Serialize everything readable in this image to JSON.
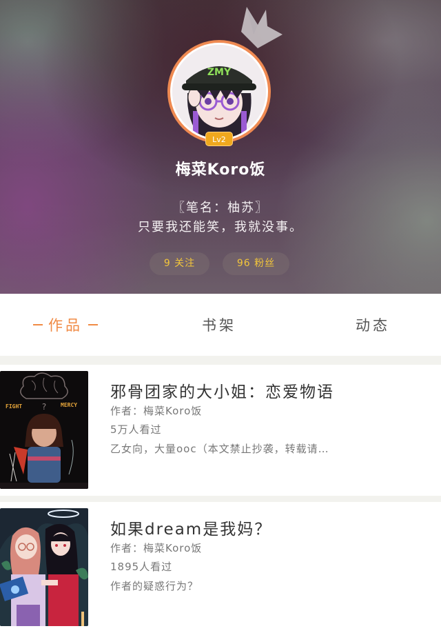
{
  "profile": {
    "username": "梅菜Koro饭",
    "level": "Lv2",
    "bio_line1": "〖笔名：柚苏〗",
    "bio_line2": "只要我还能笑，我就没事。",
    "follow_label": "9 关注",
    "fans_label": "96 粉丝"
  },
  "tabs": {
    "works": "作品",
    "shelf": "书架",
    "moments": "动态"
  },
  "works": [
    {
      "title": "邪骨团家的大小姐：恋爱物语",
      "author": "作者：梅菜Koro饭",
      "views": "5万人看过",
      "summary": "乙女向，大量ooc（本文禁止抄袭，转载请…",
      "cover_text_left": "FIGHT",
      "cover_text_right": "MERCY"
    },
    {
      "title": "如果dream是我妈？",
      "author": "作者：梅菜Koro饭",
      "views": "1895人看过",
      "summary": "作者的疑惑行为？"
    }
  ],
  "colors": {
    "accent_orange": "#f08a44",
    "stat_yellow": "#f3c63b",
    "level_badge": "#f0a81e"
  }
}
